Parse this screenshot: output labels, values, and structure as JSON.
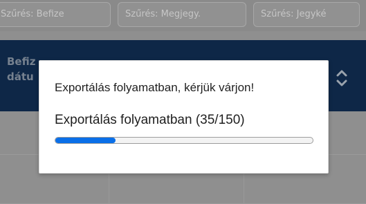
{
  "filters": [
    {
      "label": "Szűrés: Befize"
    },
    {
      "label": "Szűrés: Megjegy."
    },
    {
      "label": "Szűrés: Jegyké"
    }
  ],
  "table": {
    "header_title": "Befiz\ndátu",
    "sort_icon": "chevron-up-down-icon"
  },
  "dialog": {
    "message": "Exportálás folyamatban, kérjük várjon!",
    "progress_text": "Exportálás folyamatban (35/150)",
    "progress": {
      "current": 35,
      "total": 150
    },
    "accent_color": "#0a6fe8"
  }
}
